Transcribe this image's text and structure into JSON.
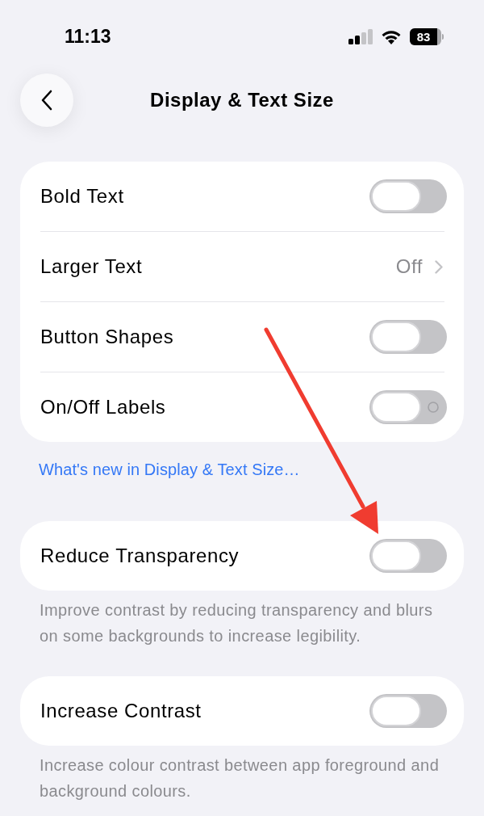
{
  "status_bar": {
    "time": "11:13",
    "battery": "83"
  },
  "nav": {
    "title": "Display & Text Size"
  },
  "sections": [
    {
      "rows": [
        {
          "kind": "toggle",
          "label": "Bold Text",
          "on": false,
          "off_symbol": false
        },
        {
          "kind": "link",
          "label": "Larger Text",
          "value": "Off"
        },
        {
          "kind": "toggle",
          "label": "Button Shapes",
          "on": false,
          "off_symbol": false
        },
        {
          "kind": "toggle",
          "label": "On/Off Labels",
          "on": false,
          "off_symbol": true
        }
      ],
      "footer_link": "What's new in Display & Text Size…"
    },
    {
      "rows": [
        {
          "kind": "toggle",
          "label": "Reduce Transparency",
          "on": false,
          "off_symbol": false
        }
      ],
      "footer": "Improve contrast by reducing transparency and blurs on some backgrounds to increase legibility."
    },
    {
      "rows": [
        {
          "kind": "toggle",
          "label": "Increase Contrast",
          "on": false,
          "off_symbol": false
        }
      ],
      "footer": "Increase colour contrast between app foreground and background colours."
    }
  ]
}
